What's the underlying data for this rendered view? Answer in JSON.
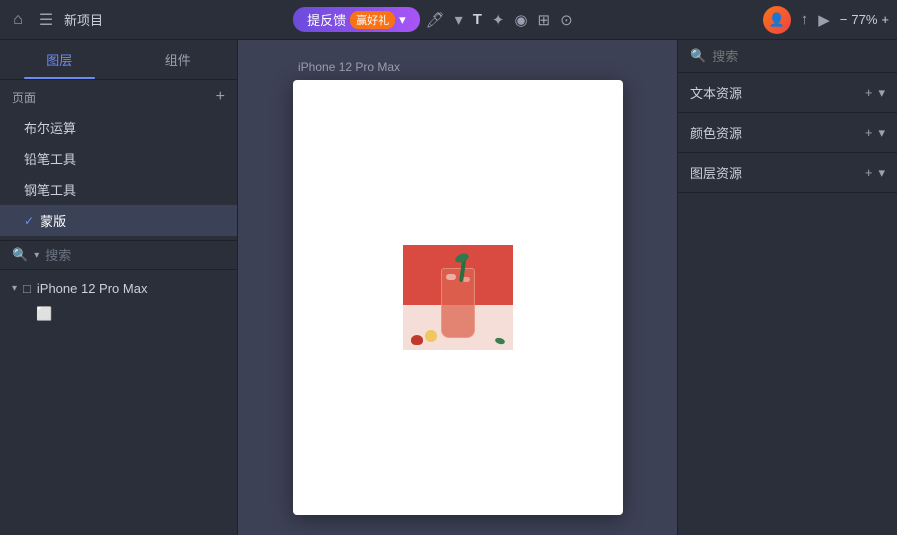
{
  "topbar": {
    "home_icon": "⌂",
    "menu_icon": "☰",
    "title": "新项目",
    "project_pill_label": "提反馈",
    "project_pill_badge": "赢好礼",
    "tool_pen": "✏",
    "tool_text": "T",
    "tool_move": "✦",
    "tool_circle": "◉",
    "tool_grid": "⊞",
    "tool_settings": "⊙",
    "dropdown_arrow": "▾",
    "avatar_text": "👤",
    "share_icon": "↑",
    "play_icon": "▶",
    "minus_icon": "−",
    "zoom_level": "77%",
    "plus_icon": "+"
  },
  "left_panel": {
    "tabs": [
      {
        "label": "图层",
        "active": true
      },
      {
        "label": "组件",
        "active": false
      }
    ],
    "pages_label": "页面",
    "add_page_label": "+",
    "pages": [
      {
        "label": "布尔运算",
        "active": false
      },
      {
        "label": "铅笔工具",
        "active": false
      },
      {
        "label": "钢笔工具",
        "active": false
      },
      {
        "label": "蒙版",
        "active": true
      }
    ],
    "search_placeholder": "搜索",
    "layers": [
      {
        "label": "iPhone 12 Pro Max",
        "icon": "□",
        "expanded": true
      },
      {
        "sub_label": "image",
        "icon": "⬜"
      }
    ]
  },
  "canvas": {
    "frame_label": "iPhone 12 Pro Max"
  },
  "right_panel": {
    "search_placeholder": "搜索",
    "resources": [
      {
        "label": "文本资源"
      },
      {
        "label": "颜色资源"
      },
      {
        "label": "图层资源"
      }
    ]
  }
}
